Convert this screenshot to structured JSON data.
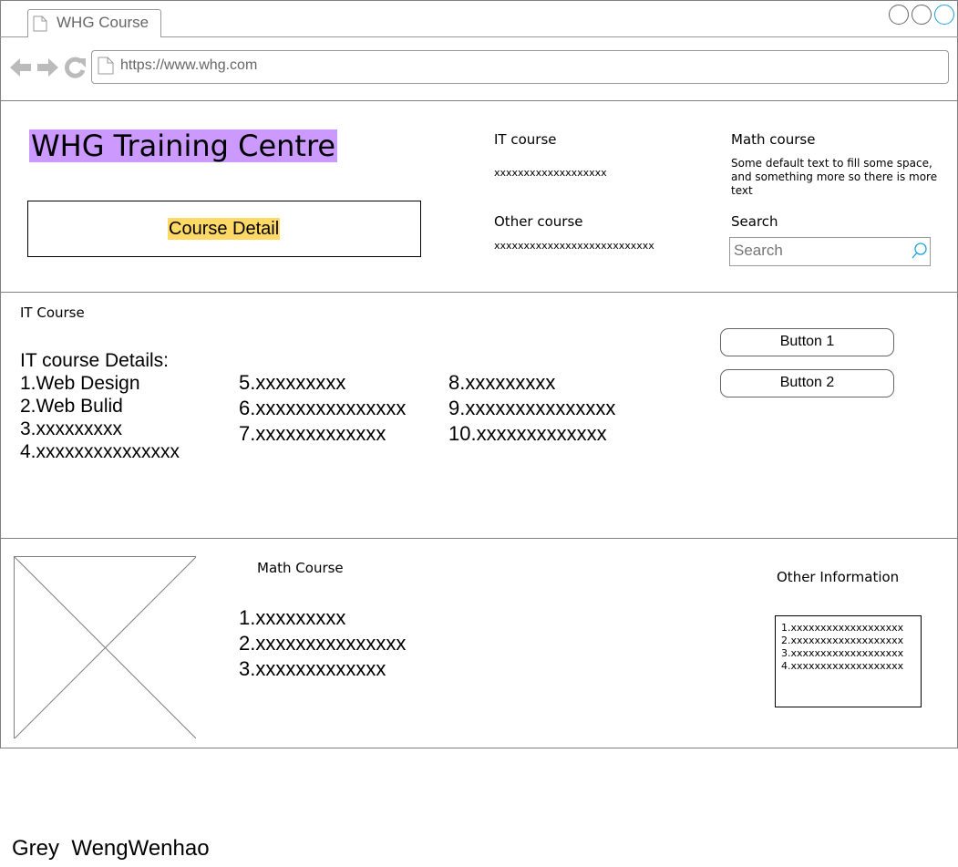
{
  "browser": {
    "tab_title": "WHG Course",
    "url": "https://www.whg.com"
  },
  "header": {
    "site_title": "WHG Training Centre",
    "course_detail_button": "Course Detail",
    "it_course": {
      "label": "IT course",
      "value": "xxxxxxxxxxxxxxxxxxx"
    },
    "math_course": {
      "label": "Math course",
      "text": "Some default text to fill some space, and something more so there is more text"
    },
    "other_course": {
      "label": "Other course",
      "value": "xxxxxxxxxxxxxxxxxxxxxxxxxxx"
    },
    "search": {
      "label": "Search",
      "placeholder": "Search"
    }
  },
  "it_section": {
    "heading": "IT Course",
    "details_title": "IT course Details:",
    "col1": [
      "1.Web Design",
      "2.Web Bulid",
      "3.xxxxxxxxx",
      "4.xxxxxxxxxxxxxxx"
    ],
    "col2": [
      "5.xxxxxxxxx",
      "6.xxxxxxxxxxxxxxx",
      "7.xxxxxxxxxxxxx"
    ],
    "col3": [
      "8.xxxxxxxxx",
      "9.xxxxxxxxxxxxxxx",
      "10.xxxxxxxxxxxxx"
    ],
    "button1": "Button 1",
    "button2": "Button 2"
  },
  "bottom": {
    "math_heading": "Math Course",
    "math_items": [
      "1.xxxxxxxxx",
      "2.xxxxxxxxxxxxxxx",
      "3.xxxxxxxxxxxxx"
    ],
    "other_heading": "Other Information",
    "other_items": [
      "1.xxxxxxxxxxxxxxxxxxx",
      "2.xxxxxxxxxxxxxxxxxxx",
      "3.xxxxxxxxxxxxxxxxxxx",
      "4.xxxxxxxxxxxxxxxxxxx"
    ]
  },
  "author": "Grey  WengWenhao"
}
